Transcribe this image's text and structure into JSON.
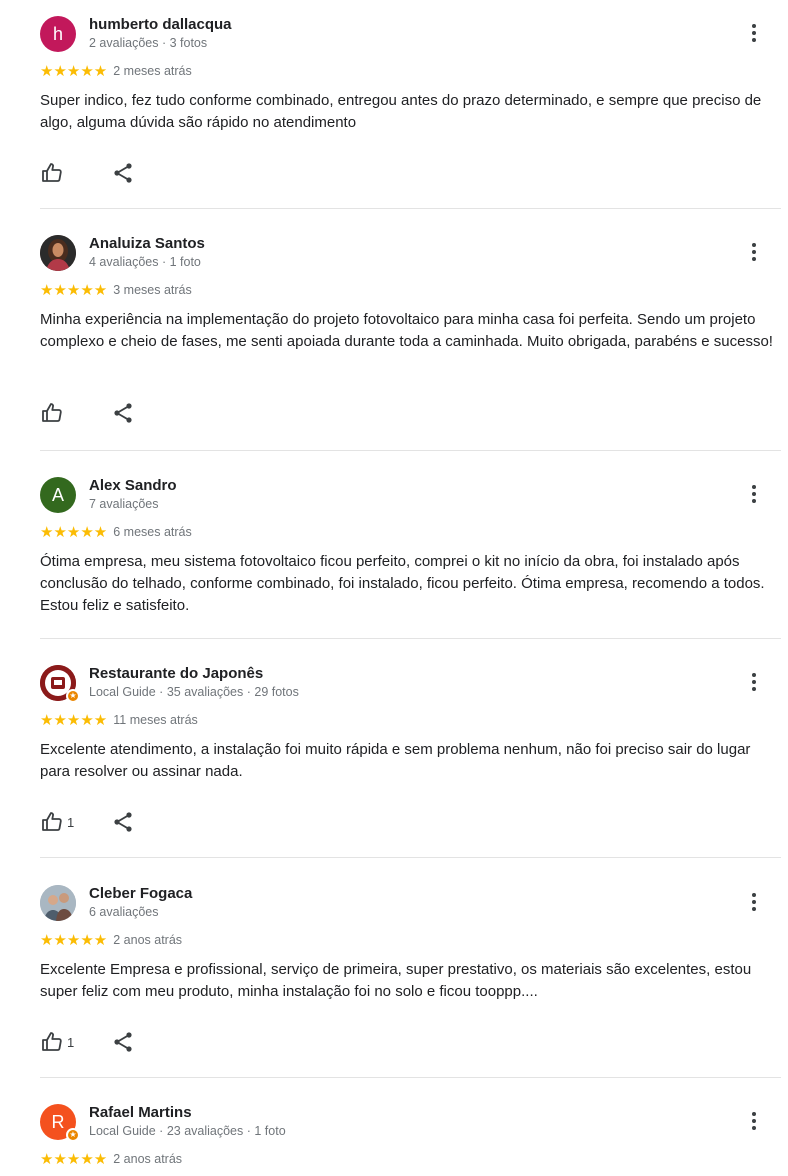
{
  "colors": {
    "star": "#fbbc04",
    "avatar_h": "#c2185b",
    "avatar_a": "#33691e",
    "avatar_r": "#f4511e",
    "local_guide_badge": "#ea8600"
  },
  "reviews": [
    {
      "avatar_letter": "h",
      "name": "humberto dallacqua",
      "meta": "2 avaliações · 3 fotos",
      "stars": "★★★★★",
      "rating": 5,
      "time": "2 meses atrás",
      "text": "Super indico, fez tudo conforme combinado, entregou antes do prazo determinado, e sempre que preciso de algo, alguma dúvida são rápido no atendimento",
      "likes": ""
    },
    {
      "avatar_letter": "",
      "name": "Analuiza Santos",
      "meta": "4 avaliações · 1 foto",
      "stars": "★★★★★",
      "rating": 5,
      "time": "3 meses atrás",
      "text": "Minha experiência na implementação do projeto fotovoltaico para minha casa foi perfeita. Sendo um projeto complexo e cheio de fases, me senti apoiada durante toda a caminhada. Muito obrigada, parabéns e sucesso!",
      "likes": ""
    },
    {
      "avatar_letter": "A",
      "name": "Alex Sandro",
      "meta": "7 avaliações",
      "stars": "★★★★★",
      "rating": 5,
      "time": "6 meses atrás",
      "text": "Ótima empresa, meu sistema fotovoltaico ficou perfeito, comprei o kit no início da obra, foi instalado após conclusão do telhado, conforme combinado, foi instalado, ficou perfeito. Ótima empresa, recomendo a todos. Estou feliz e satisfeito.",
      "likes": ""
    },
    {
      "avatar_letter": "",
      "name": "Restaurante do Japonês",
      "meta": "Local Guide · 35 avaliações · 29 fotos",
      "stars": "★★★★★",
      "rating": 5,
      "time": "11 meses atrás",
      "text": "Excelente atendimento, a instalação foi muito rápida e sem problema nenhum, não foi preciso sair do lugar para resolver ou assinar nada.",
      "likes": "1"
    },
    {
      "avatar_letter": "",
      "name": "Cleber Fogaca",
      "meta": "6 avaliações",
      "stars": "★★★★★",
      "rating": 5,
      "time": "2 anos atrás",
      "text": "Excelente Empresa e profissional, serviço de primeira, super prestativo, os materiais são excelentes, estou super feliz com meu produto, minha instalação foi no solo e ficou tooppp....",
      "likes": "1"
    },
    {
      "avatar_letter": "R",
      "name": "Rafael Martins",
      "meta": "Local Guide · 23 avaliações · 1 foto",
      "stars": "★★★★★",
      "rating": 5,
      "time": "2 anos atrás",
      "text": "",
      "likes": ""
    }
  ],
  "icons": {
    "like": "thumb-up-icon",
    "share": "share-icon",
    "more": "more-vert-icon"
  }
}
